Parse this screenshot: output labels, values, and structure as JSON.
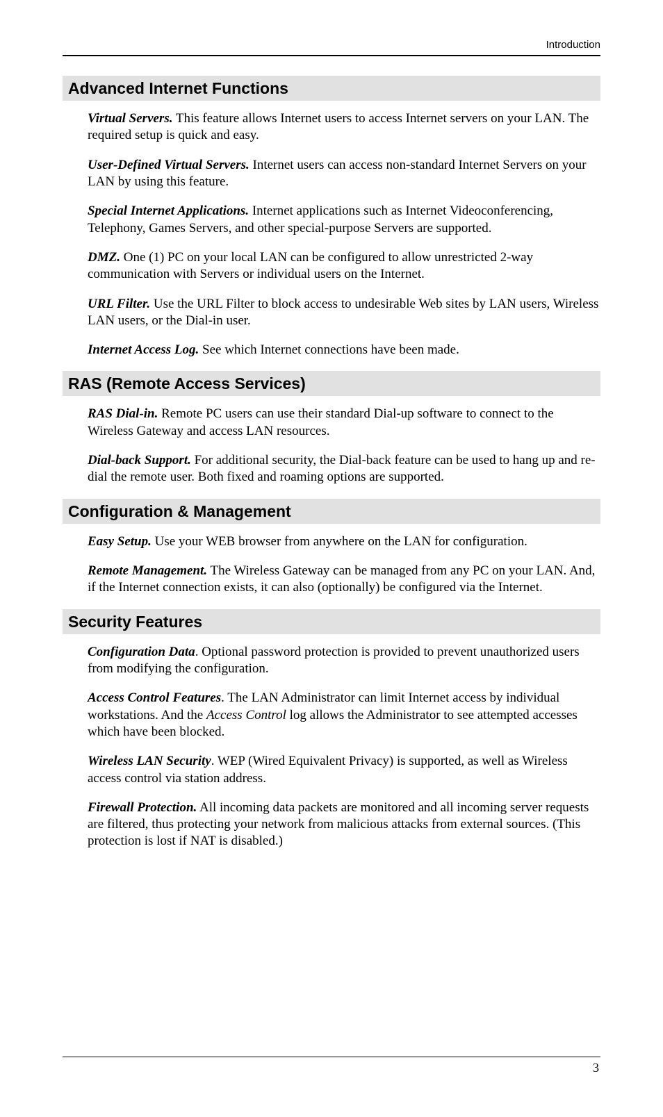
{
  "header": {
    "label": "Introduction"
  },
  "sections": {
    "s0": {
      "heading": "Advanced Internet Functions",
      "f0": {
        "title": "Virtual Servers.",
        "body": "  This feature allows Internet users to access Internet servers on your LAN. The required setup is quick and easy."
      },
      "f1": {
        "title": "User-Defined Virtual Servers.",
        "body": "  Internet users can access non-standard Internet Servers on your LAN by using this feature."
      },
      "f2": {
        "title": "Special Internet Applications.",
        "body": "  Internet applications such as Internet Videoconferenc­ing, Telephony, Games Servers, and other special-purpose Servers are supported."
      },
      "f3": {
        "title": "DMZ.",
        "body": "  One (1) PC on your local LAN can be configured to allow unrestricted 2-way communication with Servers or individual users on the Internet."
      },
      "f4": {
        "title": "URL Filter.",
        "body": "  Use the URL Filter to block access to undesirable Web sites by LAN users, Wireless LAN users, or the Dial-in user."
      },
      "f5": {
        "title": "Internet Access Log.",
        "body": "  See which Internet connections have been made."
      }
    },
    "s1": {
      "heading": "RAS (Remote Access Services)",
      "f0": {
        "title": "RAS Dial-in.",
        "body": "  Remote PC users can use their standard Dial-up software to connect to the Wireless Gateway and access LAN resources."
      },
      "f1": {
        "title": "Dial-back Support.",
        "body": "  For additional security, the Dial-back feature can be used to hang up and re-dial the remote user. Both fixed and roaming options are supported."
      }
    },
    "s2": {
      "heading": "Configuration & Management",
      "f0": {
        "title": "Easy Setup.",
        "body": "  Use your WEB browser from anywhere on the LAN for configuration."
      },
      "f1": {
        "title": "Remote Management.",
        "body": "  The Wireless Gateway can be managed from any PC on your LAN. And, if the Internet connection exists, it can also (optionally) be configured via the Internet."
      }
    },
    "s3": {
      "heading": "Security Features",
      "f0": {
        "title": "Configuration Data",
        "body": ".  Optional password protection is provided to prevent unauthorized users from modifying the configuration."
      },
      "f1": {
        "title": "Access Control Features",
        "body_pre": ".  The LAN Administrator can limit Internet access by individ­ual workstations. And the ",
        "body_em": "Access Control",
        "body_post": " log allows the Administrator to see attempted accesses which have been blocked."
      },
      "f2": {
        "title": "Wireless LAN Security",
        "body": ".  WEP (Wired Equivalent Privacy) is supported, as well as Wireless access control via station address."
      },
      "f3": {
        "title": "Firewall Protection.",
        "body": "  All incoming data packets are monitored and all incoming server requests are filtered, thus protecting your network from malicious attacks from external sources. (This protection is lost if NAT is disabled.)"
      }
    }
  },
  "footer": {
    "page_number": "3"
  }
}
